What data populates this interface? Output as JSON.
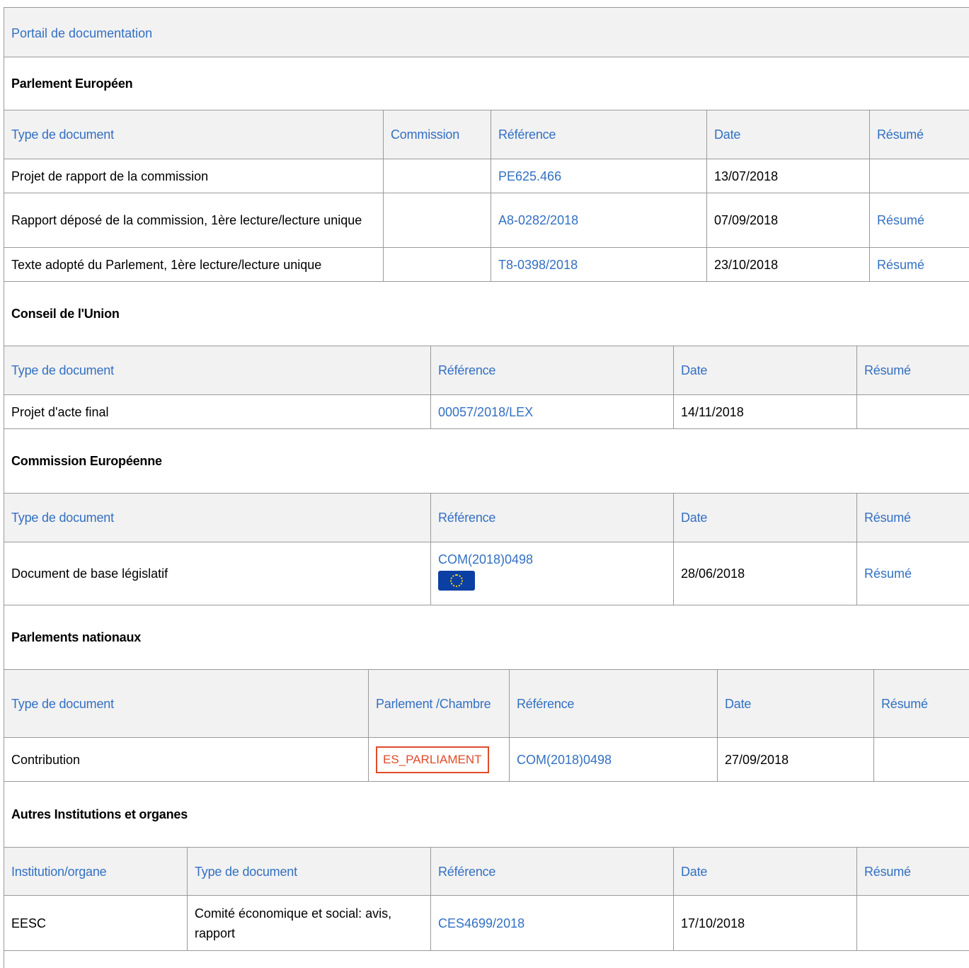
{
  "portal": {
    "title": "Portail de documentation"
  },
  "sections": {
    "ep": {
      "title": "Parlement Européen",
      "headers": {
        "type": "Type de document",
        "committee": "Commission",
        "reference": "Référence",
        "date": "Date",
        "summary": "Résumé"
      },
      "rows": [
        {
          "type": "Projet de rapport de la commission",
          "committee": "",
          "reference": "PE625.466",
          "date": "13/07/2018",
          "summary": ""
        },
        {
          "type": "Rapport déposé de la commission, 1ère lecture/lecture unique",
          "committee": "",
          "reference": "A8-0282/2018",
          "date": "07/09/2018",
          "summary": "Résumé"
        },
        {
          "type": "Texte adopté du Parlement, 1ère lecture/lecture unique",
          "committee": "",
          "reference": "T8-0398/2018",
          "date": "23/10/2018",
          "summary": "Résumé"
        }
      ]
    },
    "council": {
      "title": "Conseil de l'Union",
      "headers": {
        "type": "Type de document",
        "reference": "Référence",
        "date": "Date",
        "summary": "Résumé"
      },
      "rows": [
        {
          "type": "Projet d'acte final",
          "reference": "00057/2018/LEX",
          "date": "14/11/2018",
          "summary": ""
        }
      ]
    },
    "commission": {
      "title": "Commission Européenne",
      "headers": {
        "type": "Type de document",
        "reference": "Référence",
        "date": "Date",
        "summary": "Résumé"
      },
      "rows": [
        {
          "type": "Document de base législatif",
          "reference": "COM(2018)0498",
          "flag_icon": "eu-flag-icon",
          "date": "28/06/2018",
          "summary": "Résumé"
        }
      ]
    },
    "national": {
      "title": "Parlements nationaux",
      "headers": {
        "type": "Type de document",
        "chamber": "Parlement /Chambre",
        "reference": "Référence",
        "date": "Date",
        "summary": "Résumé"
      },
      "rows": [
        {
          "type": "Contribution",
          "chamber": "ES_PARLIAMENT",
          "reference": "COM(2018)0498",
          "date": "27/09/2018",
          "summary": ""
        }
      ]
    },
    "other": {
      "title": "Autres Institutions et organes",
      "headers": {
        "institution": "Institution/organe",
        "type": "Type de document",
        "reference": "Référence",
        "date": "Date",
        "summary": "Résumé"
      },
      "rows": [
        {
          "institution": "EESC",
          "type": "Comité économique et social: avis, rapport",
          "reference": "CES4699/2018",
          "date": "17/10/2018",
          "summary": ""
        }
      ]
    }
  },
  "colors": {
    "link": "#3370c2",
    "header_bg": "#f2f2f2",
    "border": "#9a9a9a",
    "badge": "#e04b2a",
    "flag": "#0b3fa3"
  }
}
